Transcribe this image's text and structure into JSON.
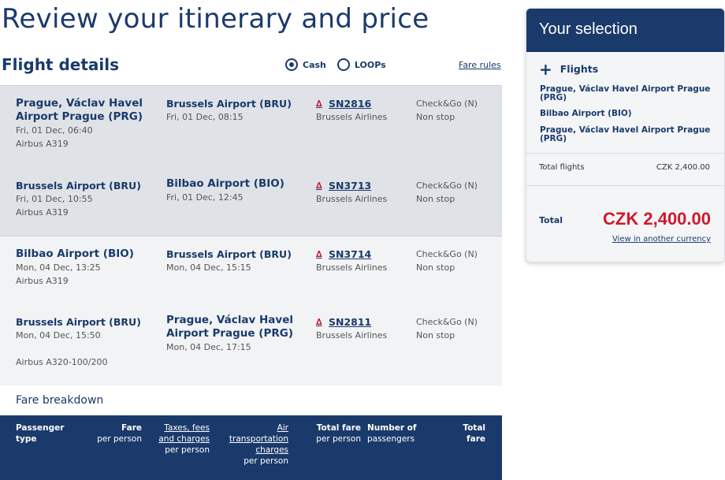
{
  "page_title": "Review your itinerary and price",
  "section_title": "Flight details",
  "payment": {
    "cash": "Cash",
    "loops": "LOOPs",
    "selected": "cash"
  },
  "fare_rules": "Fare rules",
  "segments": [
    {
      "from": "Prague, Václav Havel Airport Prague (PRG)",
      "dep": "Fri, 01 Dec, 06:40",
      "aircraft": "Airbus A319",
      "to": "Brussels Airport (BRU)",
      "arr": "Fri, 01 Dec, 08:15",
      "flight": "SN2816",
      "airline": "Brussels Airlines",
      "fare_family": "Check&Go (N)",
      "stops": "Non stop"
    },
    {
      "from": "Brussels Airport (BRU)",
      "dep": "Fri, 01 Dec, 10:55",
      "aircraft": "Airbus A319",
      "to": "Bilbao Airport (BIO)",
      "arr": "Fri, 01 Dec, 12:45",
      "flight": "SN3713",
      "airline": "Brussels Airlines",
      "fare_family": "Check&Go (N)",
      "stops": "Non stop"
    },
    {
      "from": "Bilbao Airport (BIO)",
      "dep": "Mon, 04 Dec, 13:25",
      "aircraft": "Airbus A319",
      "to": "Brussels Airport (BRU)",
      "arr": "Mon, 04 Dec, 15:15",
      "flight": "SN3714",
      "airline": "Brussels Airlines",
      "fare_family": "Check&Go (N)",
      "stops": "Non stop"
    },
    {
      "from": "Brussels Airport (BRU)",
      "dep": "Mon, 04 Dec, 15:50",
      "aircraft": "Airbus A320-100/200",
      "to": "Prague, Václav Havel Airport Prague (PRG)",
      "arr": "Mon, 04 Dec, 17:15",
      "flight": "SN2811",
      "airline": "Brussels Airlines",
      "fare_family": "Check&Go (N)",
      "stops": "Non stop"
    }
  ],
  "fare_breakdown": {
    "title": "Fare breakdown",
    "headers": {
      "passenger_type_1": "Passenger",
      "passenger_type_2": "type",
      "fare_1": "Fare",
      "fare_2": "per person",
      "taxes_1": "Taxes, fees",
      "taxes_2": "and charges",
      "taxes_3": "per person",
      "air_1": "Air",
      "air_2": "transportation",
      "air_3": "charges",
      "air_4": "per person",
      "total_pp_1": "Total fare",
      "total_pp_2": "per person",
      "num_1": "Number of",
      "num_2": "passengers",
      "total_fare": "Total fare"
    }
  },
  "selection": {
    "title": "Your selection",
    "flights_label": "Flights",
    "routes": [
      "Prague, Václav Havel Airport Prague (PRG)",
      "Bilbao Airport (BIO)",
      "Prague, Václav Havel Airport Prague (PRG)"
    ],
    "total_flights_label": "Total flights",
    "total_flights_value": "CZK 2,400.00",
    "total_label": "Total",
    "total_value": "CZK 2,400.00",
    "other_currency": "View in another currency"
  },
  "icons": {
    "radio": "radio-icon",
    "airline": "brussels-airlines-logo-icon",
    "expand": "plus-icon"
  },
  "colors": {
    "brand_blue": "#1a3a6b",
    "price_red": "#d0182c",
    "outbound_bg": "#dfe2e7",
    "inbound_bg": "#f2f3f5"
  }
}
